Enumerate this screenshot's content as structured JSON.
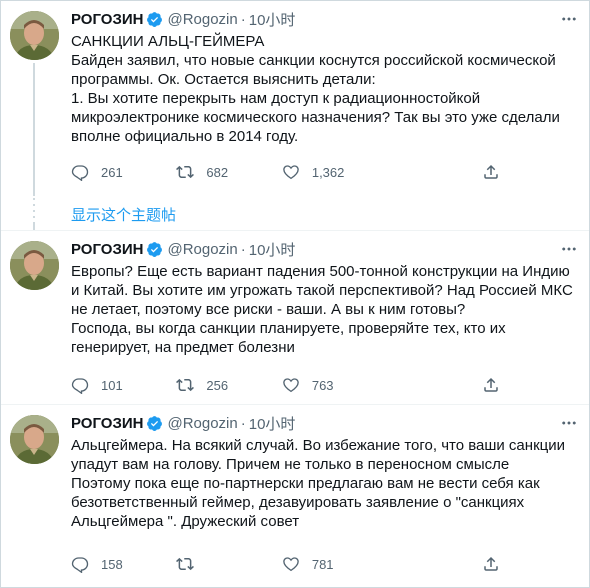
{
  "tweets": [
    {
      "author_name": "РОГОЗИН",
      "handle": "@Rogozin",
      "separator": "·",
      "time": "10小时",
      "lines": [
        "САНКЦИИ АЛЬЦ-ГЕЙМЕРА",
        "Байден заявил, что новые санкции коснутся российской космической",
        "программы. Ок. Остается выяснить детали:",
        "1. Вы хотите перекрыть нам доступ к радиационностойкой",
        "микроэлектронике космического назначения? Так вы это уже сделали",
        "вполне официально в 2014 году."
      ],
      "reply_count": "261",
      "retweet_count": "682",
      "like_count": "1,362"
    },
    {
      "author_name": "РОГОЗИН",
      "handle": "@Rogozin",
      "separator": "·",
      "time": "10小时",
      "lines": [
        "Европы? Еще есть вариант падения 500-тонной конструкции на Индию",
        "и Китай. Вы хотите им угрожать такой перспективой? Над Россией МКС",
        "не летает, поэтому все риски - ваши. А вы к ним готовы?",
        "Господа, вы когда санкции планируете, проверяйте тех, кто их",
        "генерирует, на предмет болезни"
      ],
      "reply_count": "101",
      "retweet_count": "256",
      "like_count": "763"
    },
    {
      "author_name": "РОГОЗИН",
      "handle": "@Rogozin",
      "separator": "·",
      "time": "10小时",
      "lines": [
        "Альцгеймера. На всякий случай. Во избежание того, что ваши санкции",
        "упадут вам на голову. Причем не только в переносном смысле",
        "Поэтому пока еще по-партнерски предлагаю вам не вести себя как",
        "безответственный геймер, дезавуировать заявление о \"санкциях",
        "Альцгеймера \". Дружеский совет"
      ],
      "reply_count": "158",
      "retweet_count": "",
      "like_count": "781"
    }
  ],
  "show_thread_label": "显示这个主题帖",
  "icons": {
    "verified": "verified-badge-icon",
    "more": "more-options-icon",
    "reply": "reply-icon",
    "retweet": "retweet-icon",
    "like": "like-icon",
    "share": "share-icon"
  },
  "colors": {
    "verified": "#1d9bf0",
    "link": "#1d9bf0",
    "secondary_text": "#536471",
    "border": "#cfd9de"
  }
}
